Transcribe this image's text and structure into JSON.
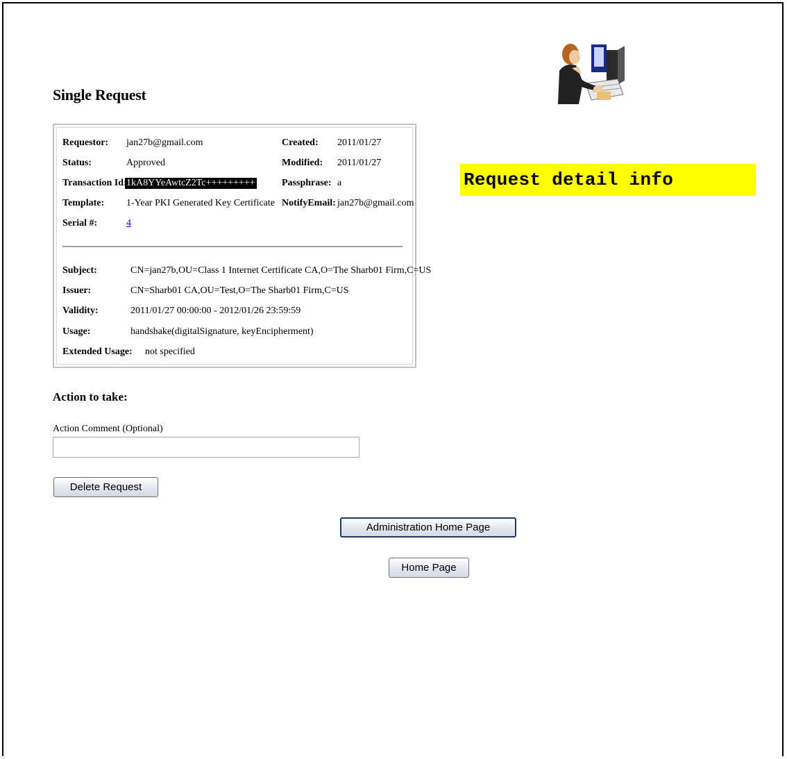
{
  "page": {
    "title": "Single Request",
    "annotation": "Request detail info"
  },
  "request": {
    "requestor_label": "Requestor:",
    "requestor": "jan27b@gmail.com",
    "created_label": "Created:",
    "created": "2011/01/27",
    "status_label": "Status:",
    "status": "Approved",
    "modified_label": "Modified:",
    "modified": "2011/01/27",
    "transaction_label": "Transaction Id:",
    "transaction_id": "1kA8YYeAwtcZ2Tc+++++++++",
    "passphrase_label": "Passphrase:",
    "passphrase": "a",
    "template_label": "Template:",
    "template": "1-Year PKI Generated Key Certificate",
    "notify_label": "NotifyEmail:",
    "notify_email": "jan27b@gmail.com",
    "serial_label": "Serial #:",
    "serial": "4"
  },
  "certificate": {
    "subject_label": "Subject:",
    "subject": "CN=jan27b,OU=Class 1 Internet Certificate CA,O=The Sharb01 Firm,C=US",
    "issuer_label": "Issuer:",
    "issuer": "CN=Sharb01 CA,OU=Test,O=The Sharb01 Firm,C=US",
    "validity_label": "Validity:",
    "validity": "2011/01/27 00:00:00 - 2012/01/26 23:59:59",
    "usage_label": "Usage:",
    "usage": "handshake(digitalSignature, keyEncipherment)",
    "ext_usage_label": "Extended Usage:",
    "ext_usage": "not specified"
  },
  "action": {
    "heading": "Action to take:",
    "comment_label": "Action Comment (Optional)",
    "comment_value": "",
    "delete_button": "Delete Request"
  },
  "nav": {
    "admin_home_button": "Administration Home Page",
    "home_button": "Home Page"
  },
  "colors": {
    "annotation_bg": "#ffff00",
    "link": "#0000ee",
    "transaction_highlight": "#000000"
  },
  "icons": {
    "illustration": "user-at-computer-icon"
  }
}
